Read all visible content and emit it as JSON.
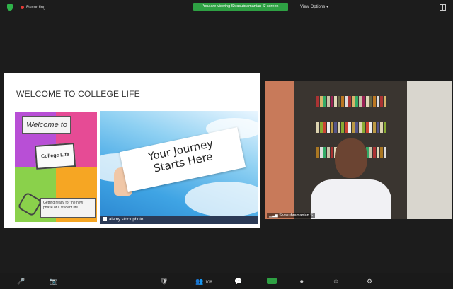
{
  "top_bar": {
    "recording_label": "Recording",
    "share_banner": "You are viewing Sivasubramanian S' screen",
    "view_options_label": "View Options"
  },
  "slide": {
    "title": "WELCOME TO COLLEGE LIFE",
    "collage": {
      "welcome_card": "Welcome to",
      "life_card": "College Life",
      "caption": "Getting ready for the new phase of a student life"
    },
    "photo": {
      "sign_line1": "Your Journey",
      "sign_line2": "Starts Here",
      "watermark": "alamy stock photo"
    }
  },
  "participant": {
    "name": "Sivasubramanian S"
  },
  "toolbar": {
    "participants_count": "108"
  }
}
